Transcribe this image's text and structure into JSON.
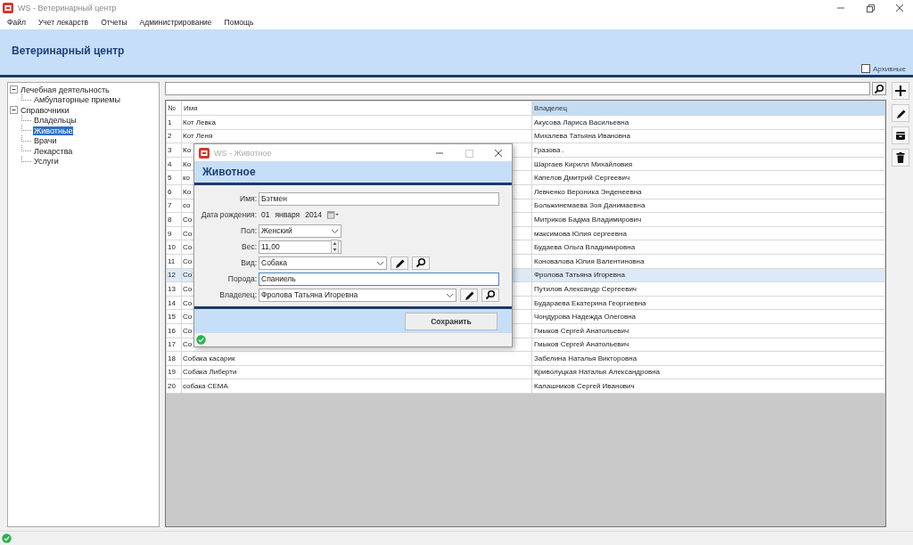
{
  "window": {
    "title": "WS - Ветеринарный центр"
  },
  "menu": [
    "Файл",
    "Учет лекарств",
    "Отчеты",
    "Администрирование",
    "Помощь"
  ],
  "header": {
    "title": "Ветеринарный центр",
    "archive": {
      "label": "Архивные",
      "checked": false
    }
  },
  "tree": [
    {
      "label": "Лечебная деятельность",
      "expanded": true,
      "selected": false,
      "children": [
        {
          "label": "Амбулаторные приемы",
          "selected": false
        }
      ]
    },
    {
      "label": "Справочники",
      "expanded": true,
      "selected": false,
      "children": [
        {
          "label": "Владельцы",
          "selected": false
        },
        {
          "label": "Животные",
          "selected": true
        },
        {
          "label": "Врачи",
          "selected": false
        },
        {
          "label": "Лекарства",
          "selected": false
        },
        {
          "label": "Услуги",
          "selected": false
        }
      ]
    }
  ],
  "table": {
    "columns": [
      {
        "label": "№",
        "sorted": false
      },
      {
        "label": "Имя",
        "sorted": false
      },
      {
        "label": "Владелец",
        "sorted": true
      }
    ],
    "rows": [
      {
        "cells": [
          "1",
          "Кот Левка",
          "Акусова  Лариса Васильевна"
        ],
        "selected": false
      },
      {
        "cells": [
          "2",
          "Кот Леня",
          "Михалева  Татьяна Ивановна"
        ],
        "selected": false
      },
      {
        "cells": [
          "3",
          "Ко",
          "Гразова ."
        ],
        "selected": false
      },
      {
        "cells": [
          "4",
          "Ко",
          "Шаргаев  Кирилл Михайловия"
        ],
        "selected": false
      },
      {
        "cells": [
          "5",
          "ко",
          "Капелов Дмитрий Сергеевич"
        ],
        "selected": false
      },
      {
        "cells": [
          "6",
          "Ко",
          "Левченко Вероника Энденеевна"
        ],
        "selected": false
      },
      {
        "cells": [
          "7",
          "со",
          "Больжинемаева Зоя Данимаевна"
        ],
        "selected": false
      },
      {
        "cells": [
          "8",
          "Со",
          "Митриков Бадма Владимирович"
        ],
        "selected": false
      },
      {
        "cells": [
          "9",
          "Со",
          "максимова Юлия сергеевна"
        ],
        "selected": false
      },
      {
        "cells": [
          "10",
          "Со",
          "Будаева Ольга Владимировна"
        ],
        "selected": false
      },
      {
        "cells": [
          "11",
          "Со",
          "Коновалова Юлия  Валентиновна"
        ],
        "selected": false
      },
      {
        "cells": [
          "12",
          "Со",
          "Фролова Татьяна Игоревна"
        ],
        "selected": true
      },
      {
        "cells": [
          "13",
          "Со",
          "Путилов  Александр Сергеевич"
        ],
        "selected": false
      },
      {
        "cells": [
          "14",
          "Со",
          "Бударaева Екатерина Георгиевна"
        ],
        "selected": false
      },
      {
        "cells": [
          "15",
          "Со",
          "Чондурова Надежда Олеговна"
        ],
        "selected": false
      },
      {
        "cells": [
          "16",
          "Со",
          "Гмыков Сергей Анатольевич"
        ],
        "selected": false
      },
      {
        "cells": [
          "17",
          "Со",
          "Гмыков Сергей Анатольевич"
        ],
        "selected": false
      },
      {
        "cells": [
          "18",
          "Собака касарик",
          "Забелина Наталья Викторовна"
        ],
        "selected": false
      },
      {
        "cells": [
          "19",
          "Собака Либерти",
          "Криволуцкая Наталья Александровна"
        ],
        "selected": false
      },
      {
        "cells": [
          "20",
          "собака СЕМА",
          "Калашников Сергей Иванович"
        ],
        "selected": false
      }
    ]
  },
  "dialog": {
    "title": "WS - Животное",
    "heading": "Животное",
    "fields": [
      {
        "kind": "text",
        "label": "Имя:",
        "value": "Бэтмен",
        "focused": false
      },
      {
        "kind": "date",
        "label": "Дата рождения:",
        "parts": [
          "01",
          "января",
          "2014"
        ],
        "focused": false
      },
      {
        "kind": "select",
        "label": "Пол:",
        "value": "Женский",
        "focused": false
      },
      {
        "kind": "number",
        "label": "Вес:",
        "value": "11,00",
        "focused": false
      },
      {
        "kind": "lookup",
        "label": "Вид:",
        "value": "Собака",
        "focused": false
      },
      {
        "kind": "text",
        "label": "Порода:",
        "value": "Спаниель",
        "focused": true
      },
      {
        "kind": "lookup",
        "label": "Владелец:",
        "value": "Фролова Татьяна Игоревна",
        "focused": false
      }
    ],
    "save": "Сохранить"
  }
}
